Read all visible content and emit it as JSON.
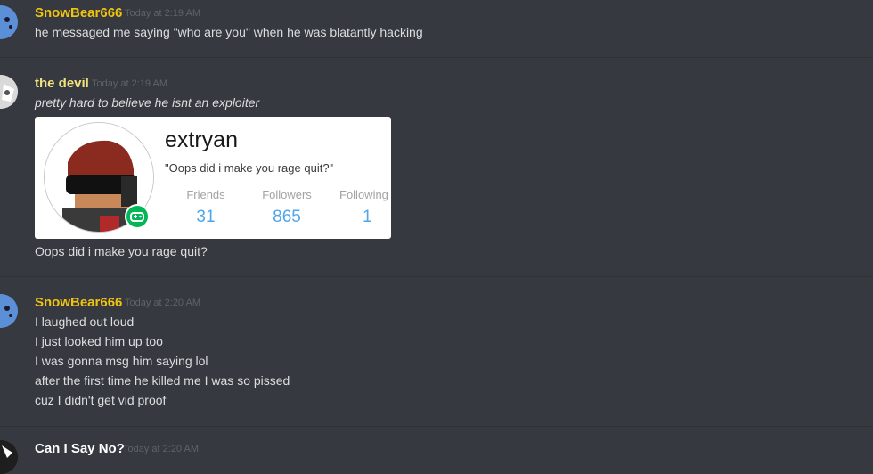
{
  "colors": {
    "background": "#36393f",
    "username_gold": "#f1c40f",
    "username_yellow": "#f1e27e",
    "text": "#dcddde",
    "timestamp": "#5f6269",
    "stat_blue": "#4fa6e8",
    "badge_green": "#02b757"
  },
  "messages": [
    {
      "author": "SnowBear666",
      "timestamp": "Today at 2:19 AM",
      "lines": [
        "he messaged me saying \"who are you\" when he was blatantly hacking"
      ]
    },
    {
      "author": "the devil",
      "timestamp": "Today at 2:19 AM",
      "lines": [
        "pretty hard to believe he isnt an exploiter"
      ],
      "embed": {
        "username": "extryan",
        "status": "\"Oops did i make you rage quit?\"",
        "stats": [
          {
            "label": "Friends",
            "value": "31"
          },
          {
            "label": "Followers",
            "value": "865"
          },
          {
            "label": "Following",
            "value": "1"
          }
        ],
        "badge_icon": "gamepad-icon"
      },
      "after_embed": "Oops did i make you rage quit?"
    },
    {
      "author": "SnowBear666",
      "timestamp": "Today at 2:20 AM",
      "lines": [
        "I laughed out loud",
        "I just looked him up too",
        "I was gonna msg him saying lol",
        "after the first time he killed me I was so pissed",
        "cuz I didn't get vid proof"
      ]
    },
    {
      "author": "Can I Say No?",
      "timestamp": "Today at 2:20 AM"
    }
  ]
}
